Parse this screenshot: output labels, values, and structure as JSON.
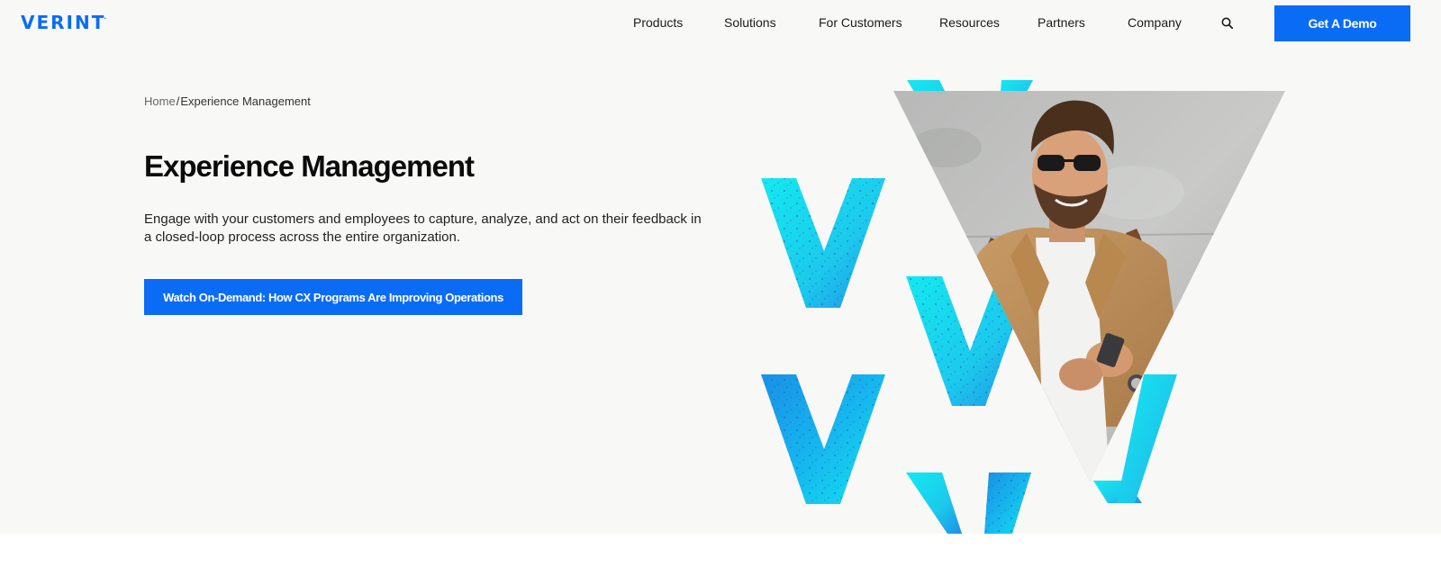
{
  "header": {
    "logo_text": "VERINT",
    "logo_mark": ".",
    "nav": [
      {
        "label": "Products"
      },
      {
        "label": "Solutions"
      },
      {
        "label": "For Customers"
      },
      {
        "label": "Resources"
      },
      {
        "label": "Partners"
      },
      {
        "label": "Company"
      }
    ],
    "search_icon": "search-icon",
    "demo_button": "Get A Demo"
  },
  "breadcrumb": {
    "home": "Home",
    "separator": "/",
    "current": "Experience Management"
  },
  "hero": {
    "title": "Experience Management",
    "description": "Engage with your customers and employees to capture, analyze, and act on their feedback in a closed-loop process across the entire organization.",
    "cta_label": "Watch On-Demand: How CX Programs Are Improving Operations"
  },
  "colors": {
    "brand_blue": "#0a6cf5",
    "accent_cyan": "#1fe3ec",
    "accent_blue": "#1a8fe6",
    "background": "#f8f8f7"
  }
}
